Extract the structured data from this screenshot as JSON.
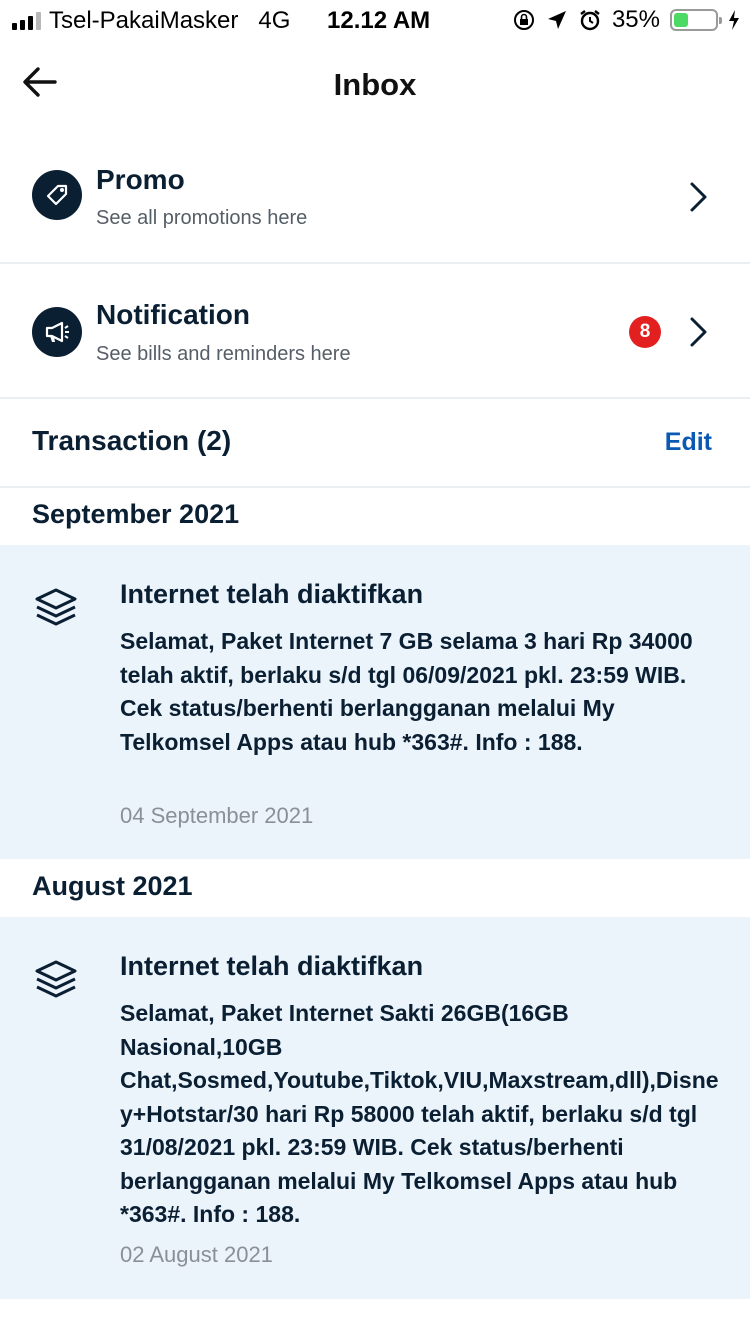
{
  "status_bar": {
    "carrier": "Tsel-PakaiMasker",
    "network": "4G",
    "time": "12.12 AM",
    "battery_percent": "35%",
    "battery_level": 0.35,
    "icons": [
      "signal-icon",
      "orientation-lock-icon",
      "location-icon",
      "alarm-icon",
      "battery-icon",
      "charging-icon"
    ]
  },
  "header": {
    "title": "Inbox"
  },
  "menu": [
    {
      "title": "Promo",
      "subtitle": "See all promotions here",
      "icon": "tag-icon"
    },
    {
      "title": "Notification",
      "subtitle": "See bills and reminders here",
      "icon": "megaphone-icon",
      "badge": "8"
    }
  ],
  "transaction": {
    "title": "Transaction (2)",
    "edit_label": "Edit"
  },
  "groups": [
    {
      "month": "September 2021",
      "items": [
        {
          "title": "Internet telah diaktifkan",
          "body": "Selamat, Paket Internet 7 GB selama 3 hari Rp 34000 telah aktif, berlaku s/d tgl 06/09/2021 pkl. 23:59 WIB. Cek status/berhenti berlangganan melalui My Telkomsel Apps atau hub *363#. Info : 188.",
          "date": "04 September 2021"
        }
      ]
    },
    {
      "month": "August 2021",
      "items": [
        {
          "title": "Internet telah diaktifkan",
          "body": "Selamat, Paket Internet Sakti 26GB(16GB Nasional,10GB Chat,Sosmed,Youtube,Tiktok,VIU,Maxstream,dll),Disney+Hotstar/30 hari Rp 58000 telah aktif, berlaku s/d tgl 31/08/2021 pkl. 23:59 WIB. Cek status/berhenti berlangganan melalui My Telkomsel Apps atau hub *363#. Info : 188.",
          "date": "02 August 2021"
        }
      ]
    }
  ],
  "colors": {
    "navy": "#0b1f33",
    "accent": "#0a59b3",
    "badge": "#e32020",
    "card_bg": "#ebf3fb"
  }
}
